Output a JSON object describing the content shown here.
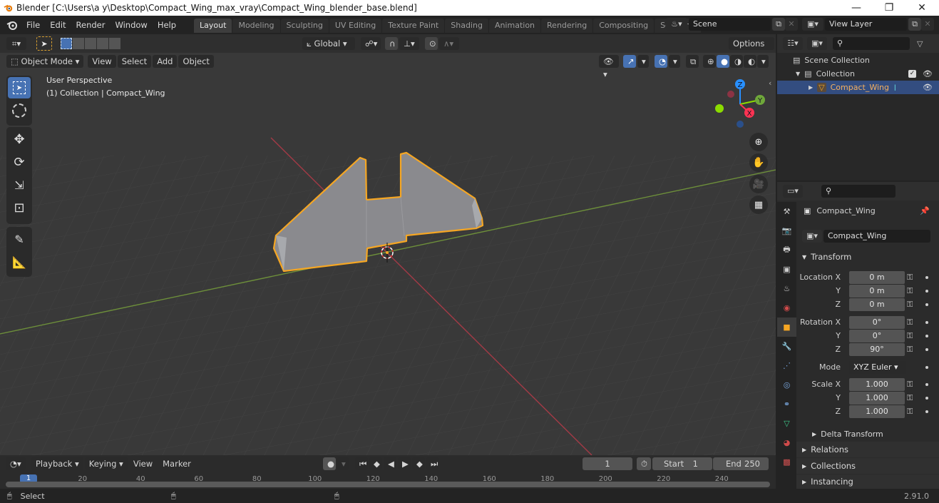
{
  "window": {
    "title": "Blender [C:\\Users\\a y\\Desktop\\Compact_Wing_max_vray\\Compact_Wing_blender_base.blend]",
    "controls": [
      "minimize",
      "restore",
      "close"
    ]
  },
  "menu": [
    "File",
    "Edit",
    "Render",
    "Window",
    "Help"
  ],
  "workspaces": [
    {
      "label": "Layout",
      "active": true
    },
    {
      "label": "Modeling",
      "active": false
    },
    {
      "label": "Sculpting",
      "active": false
    },
    {
      "label": "UV Editing",
      "active": false
    },
    {
      "label": "Texture Paint",
      "active": false
    },
    {
      "label": "Shading",
      "active": false
    },
    {
      "label": "Animation",
      "active": false
    },
    {
      "label": "Rendering",
      "active": false
    },
    {
      "label": "Compositing",
      "active": false
    },
    {
      "label": "Scripting",
      "active": false
    }
  ],
  "add_workspace": "+",
  "scene": {
    "name": "Scene",
    "view_layer": "View Layer"
  },
  "viewport": {
    "mode": "Object Mode",
    "header_menus": [
      "View",
      "Select",
      "Add",
      "Object"
    ],
    "transform_orientation": "Global",
    "options_label": "Options",
    "overlay_line1": "User Perspective",
    "overlay_line2": "(1) Collection | Compact_Wing",
    "gizmo": {
      "x": "X",
      "y": "Y",
      "z": "Z"
    },
    "colors": {
      "x_axis": "#ff3352",
      "y_axis": "#8bdc00",
      "z_axis": "#2890ff",
      "selection": "#f5a623",
      "active_tool": "#4772b3"
    }
  },
  "outliner": {
    "scene_collection": "Scene Collection",
    "collection": "Collection",
    "object": "Compact_Wing"
  },
  "properties": {
    "object_name": "Compact_Wing",
    "object_field": "Compact_Wing",
    "transform_label": "Transform",
    "location": {
      "label": "Location X",
      "x": "0 m",
      "y": "0 m",
      "z": "0 m"
    },
    "rotation": {
      "label": "Rotation X",
      "x": "0°",
      "y": "0°",
      "z": "90°"
    },
    "mode_label": "Mode",
    "mode_value": "XYZ Euler",
    "scale": {
      "label": "Scale X",
      "x": "1.000",
      "y": "1.000",
      "z": "1.000"
    },
    "axis_y": "Y",
    "axis_z": "Z",
    "delta_transform": "Delta Transform",
    "relations": "Relations",
    "collections": "Collections",
    "instancing": "Instancing"
  },
  "timeline": {
    "menus": [
      "Playback",
      "Keying",
      "View",
      "Marker"
    ],
    "current_frame": "1",
    "start_label": "Start",
    "start_value": "1",
    "end_label": "End",
    "end_value": "250",
    "ticks": [
      "1",
      "20",
      "40",
      "60",
      "80",
      "100",
      "120",
      "140",
      "160",
      "180",
      "200",
      "220",
      "240"
    ]
  },
  "statusbar": {
    "select_label": "Select",
    "version": "2.91.0"
  }
}
